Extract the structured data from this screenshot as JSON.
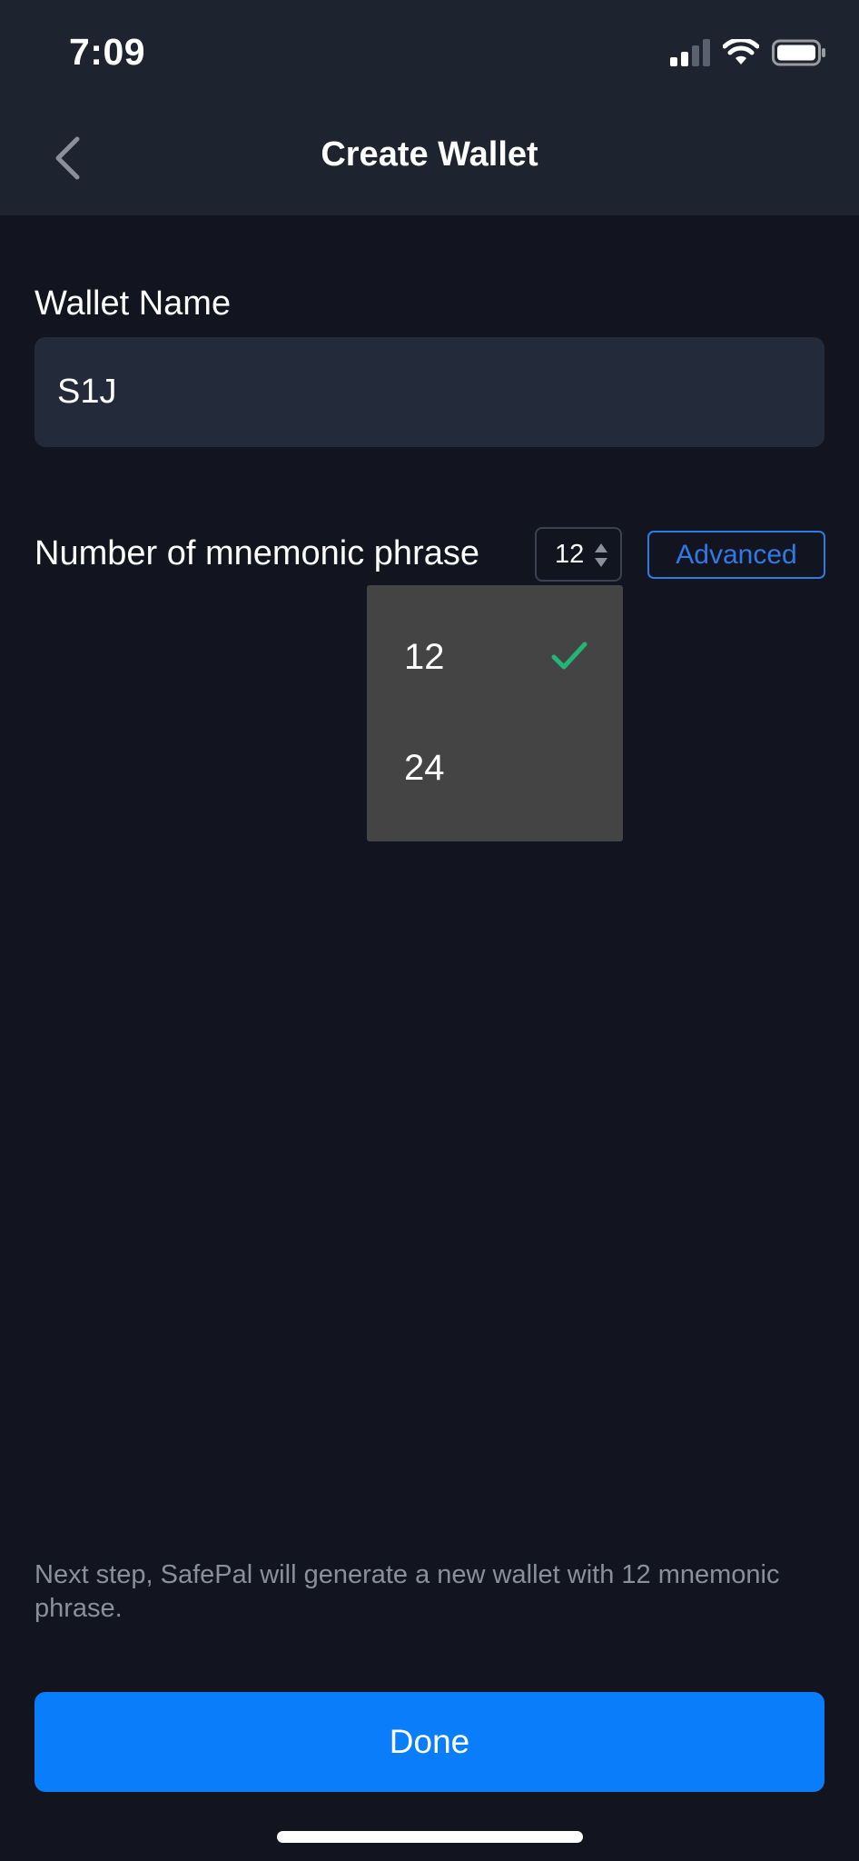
{
  "status_bar": {
    "time": "7:09"
  },
  "nav": {
    "title": "Create Wallet",
    "back_icon": "chevron-left-icon"
  },
  "wallet_name": {
    "label": "Wallet Name",
    "value": "S1J"
  },
  "mnemonic": {
    "label": "Number of mnemonic phrase",
    "selected": "12",
    "options": [
      "12",
      "24"
    ],
    "advanced_label": "Advanced"
  },
  "footer": {
    "note": "Next step, SafePal will generate a new wallet with 12 mnemonic phrase.",
    "done_label": "Done"
  },
  "colors": {
    "background": "#12151F",
    "header": "#1E2330",
    "input": "#232A3A",
    "accent": "#0A7DFB",
    "advanced": "#2F7AE5",
    "check": "#22B573",
    "dropdown": "#444444"
  }
}
